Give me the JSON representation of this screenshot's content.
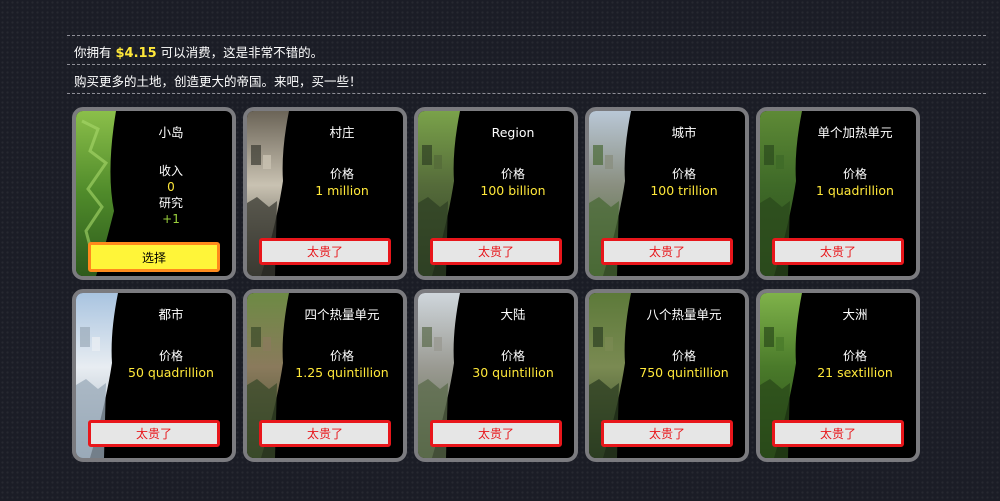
{
  "header": {
    "money_prefix": "你拥有",
    "money": "$4.15",
    "money_suffix": "可以消费，这是非常不错的。",
    "subtitle": "购买更多的土地，创造更大的帝国。来吧，买一些！"
  },
  "owned": {
    "name": "小岛",
    "income_label": "收入",
    "income_value": "0",
    "research_label": "研究",
    "research_value": "+1",
    "select_label": "选择"
  },
  "price_label": "价格",
  "too_expensive_label": "太贵了",
  "lands": [
    {
      "name": "村庄",
      "price": "1 million",
      "scene": "village"
    },
    {
      "name": "Region",
      "price": "100 billion",
      "scene": "valley"
    },
    {
      "name": "城市",
      "price": "100 trillion",
      "scene": "city"
    },
    {
      "name": "单个加热单元",
      "price": "1 quadrillion",
      "scene": "hill"
    },
    {
      "name": "都市",
      "price": "50 quadrillion",
      "scene": "skyline"
    },
    {
      "name": "四个热量单元",
      "price": "1.25 quintillion",
      "scene": "village2"
    },
    {
      "name": "大陆",
      "price": "30 quintillion",
      "scene": "towers"
    },
    {
      "name": "八个热量单元",
      "price": "750 quintillion",
      "scene": "valley2"
    },
    {
      "name": "大洲",
      "price": "21 sextillion",
      "scene": "forest"
    }
  ],
  "colors": {
    "accent_yellow": "#ffe83a",
    "income_green": "#9bd13d",
    "button_red": "#e8161b",
    "select_yellow": "#fff539"
  }
}
